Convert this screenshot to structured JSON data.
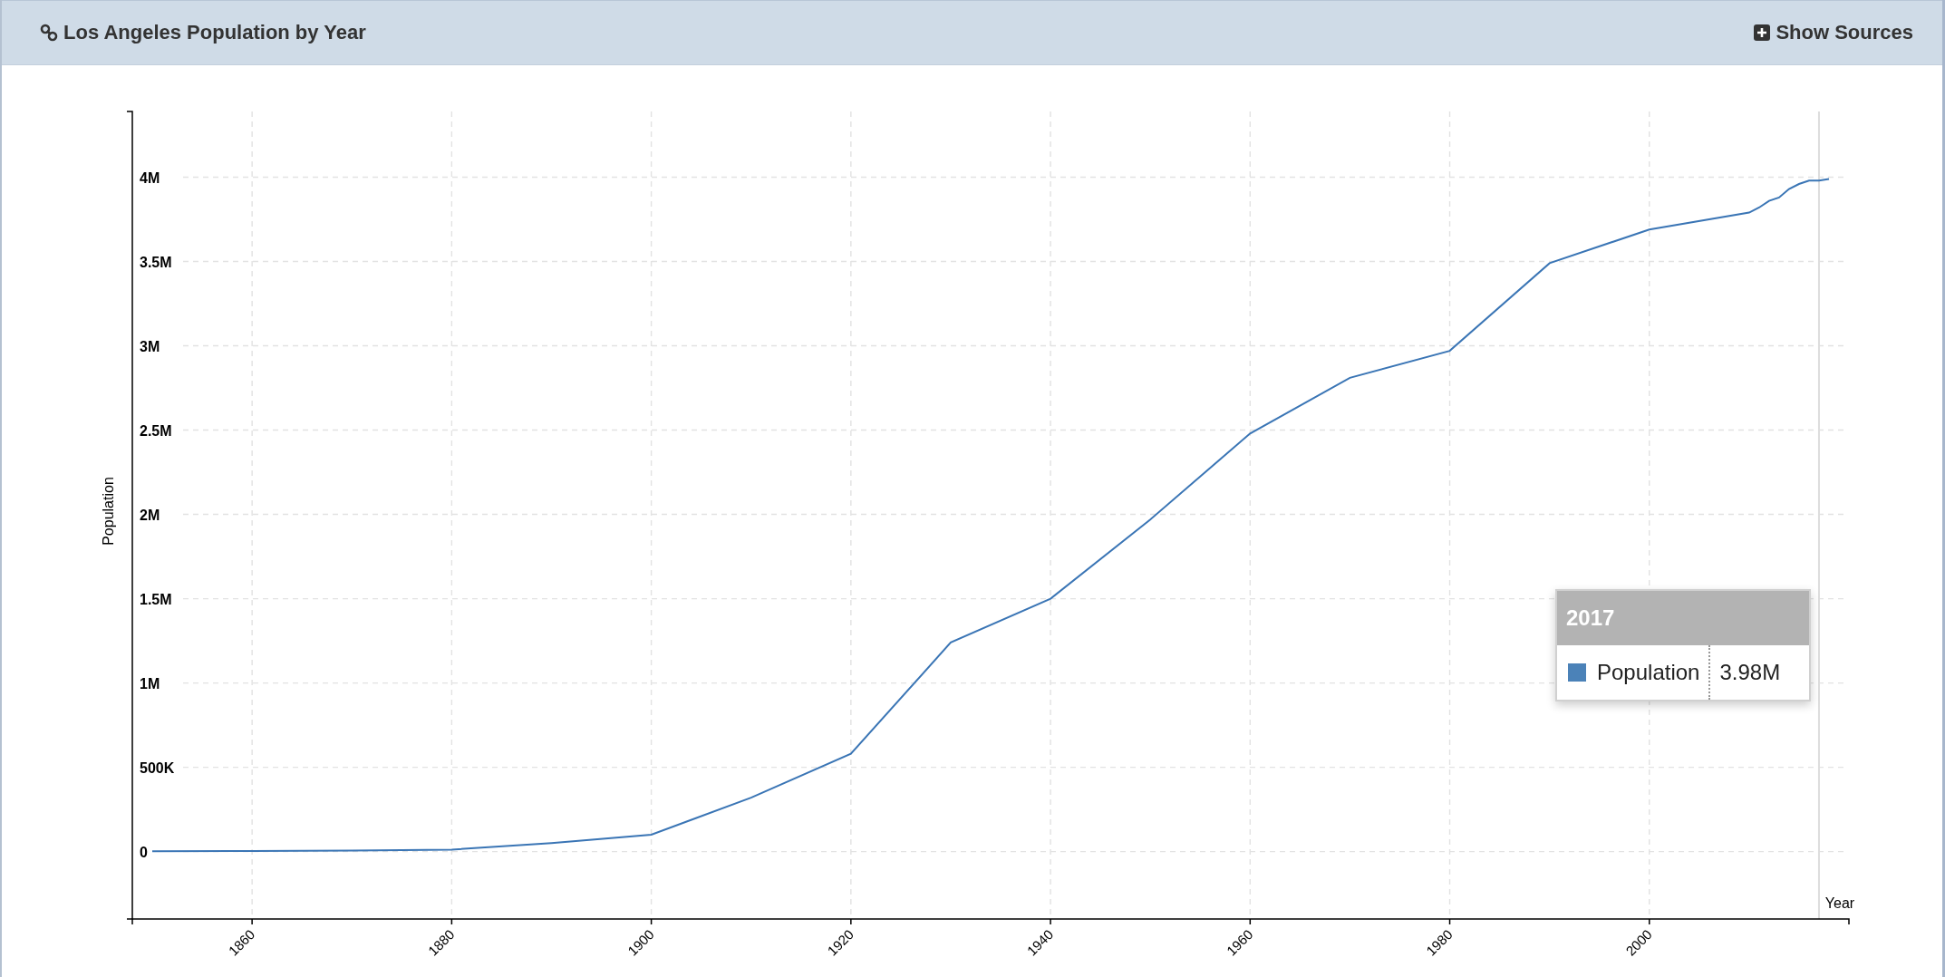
{
  "panel": {
    "title": "Los Angeles Population by Year",
    "sources_button": "Show Sources"
  },
  "chart_data": {
    "type": "line",
    "xlabel": "Year",
    "ylabel": "Population",
    "xlim": [
      1848,
      2020
    ],
    "ylim": [
      -400000,
      4390000
    ],
    "grid": true,
    "x": [
      1850,
      1860,
      1870,
      1880,
      1890,
      1900,
      1910,
      1920,
      1930,
      1940,
      1950,
      1960,
      1970,
      1980,
      1990,
      2000,
      2010,
      2011,
      2012,
      2013,
      2014,
      2015,
      2016,
      2017,
      2018
    ],
    "series": [
      {
        "name": "Population",
        "color": "#3a75b5",
        "values": [
          2000,
          4000,
          6000,
          11000,
          50000,
          100000,
          320000,
          580000,
          1240000,
          1500000,
          1970000,
          2480000,
          2810000,
          2970000,
          3490000,
          3690000,
          3790000,
          3820000,
          3860000,
          3880000,
          3930000,
          3960000,
          3980000,
          3980000,
          3990000
        ]
      }
    ],
    "xticks": [
      1860,
      1880,
      1900,
      1920,
      1940,
      1960,
      1980,
      2000
    ],
    "yticks": [
      {
        "value": 0,
        "label": "0"
      },
      {
        "value": 500000,
        "label": "500K"
      },
      {
        "value": 1000000,
        "label": "1M"
      },
      {
        "value": 1500000,
        "label": "1.5M"
      },
      {
        "value": 2000000,
        "label": "2M"
      },
      {
        "value": 2500000,
        "label": "2.5M"
      },
      {
        "value": 3000000,
        "label": "3M"
      },
      {
        "value": 3500000,
        "label": "3.5M"
      },
      {
        "value": 4000000,
        "label": "4M"
      }
    ],
    "ref_lines": [
      {
        "axis": "x",
        "value": 2017
      }
    ]
  },
  "tooltip": {
    "title": "2017",
    "rows": [
      {
        "color": "#4b82b8",
        "value": "3.98M"
      }
    ]
  }
}
